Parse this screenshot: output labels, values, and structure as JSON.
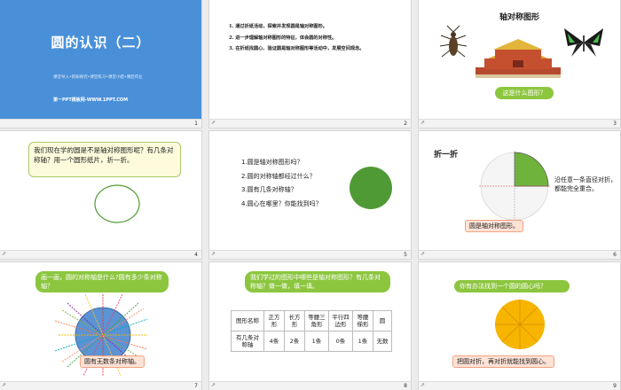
{
  "slides": {
    "s1": {
      "title": "圆的认识（二）",
      "subtitle": "课堂导入•新知探究•课堂练习•课堂小结•课后作业",
      "footer_text": "第一PPT模板网-WWW.1PPT.COM",
      "number": "1"
    },
    "s2": {
      "lines": [
        "1. 通过折纸活动，探索并发现圆是轴对称图形。",
        "2. 进一步理解轴对称图形的特征，体会圆的对称性。",
        "3. 在折纸找圆心、验证圆是轴对称图形等活动中，发展空间观念。"
      ],
      "number": "2"
    },
    "s3": {
      "title": "轴对称图形",
      "question": "这是什么图形？",
      "number": "3"
    },
    "s4": {
      "text": "我们现在学的圆是不是轴对称图形呢？有几条对称轴？用一个圆形纸片，折一折。",
      "number": "4"
    },
    "s5": {
      "items": [
        "1.圆是轴对称图形吗？",
        "2.圆的对称轴都经过什么？",
        "3.圆有几条对称轴？",
        "4.圆心在哪里？你能找到吗？"
      ],
      "number": "5"
    },
    "s6": {
      "title": "折一折",
      "side_text": "沿任意一条直径对折，都能完全重合。",
      "callout": "圆是轴对称图形。",
      "number": "6"
    },
    "s7": {
      "bubble": "画一画，圆的对称轴是什么?圆有多少条对称轴？",
      "callout": "圆有无数条对称轴。",
      "number": "7"
    },
    "s8": {
      "bubble": "我们学过的图形中哪些是轴对称图形？有几条对称轴？做一做，填一填。",
      "table": {
        "header": [
          "图形名称",
          "正方形",
          "长方形",
          "等腰三角形",
          "平行四边形",
          "等腰梯形",
          "圆"
        ],
        "row": [
          "有几条对称轴",
          "4条",
          "2条",
          "1条",
          "0条",
          "1条",
          "无数"
        ]
      },
      "number": "8"
    },
    "s9": {
      "bubble": "你有办法找到一个圆的圆心吗？",
      "callout": "把圆对折，再对折就能找到圆心。",
      "number": "9"
    }
  },
  "footer_icon": "share-icon",
  "colors": {
    "title_blue": "#4a90d9",
    "bubble_green": "#8cc63f",
    "circle_green": "#4f9a35",
    "sector_green": "#6fb33c",
    "circle_blue": "#5b93d3",
    "circle_orange": "#f7b500"
  }
}
